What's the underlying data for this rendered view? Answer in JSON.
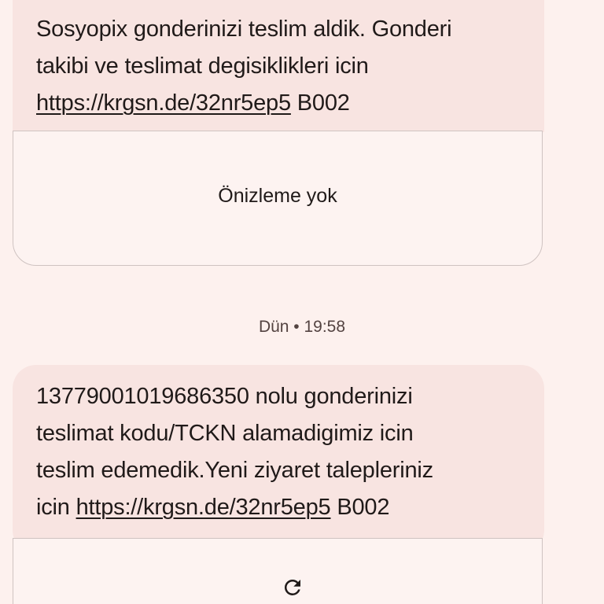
{
  "message_1": {
    "lines": [
      "Sosyopix gonderinizi teslim aldik. Gonderi",
      "takibi ve teslimat degisiklikleri icin"
    ],
    "link": "https://krgsn.de/32nr5ep5",
    "suffix": " B002",
    "preview_label": "Önizleme yok"
  },
  "timestamp": "Dün • 19:58",
  "message_2": {
    "lines": [
      "13779001019686350 nolu gonderinizi",
      "teslimat kodu/TCKN alamadigimiz icin",
      "teslim edemedik.Yeni ziyaret talepleriniz"
    ],
    "prefix": "icin ",
    "link": "https://krgsn.de/32nr5ep5",
    "suffix": " B002",
    "preview_icon": "refresh-icon"
  }
}
